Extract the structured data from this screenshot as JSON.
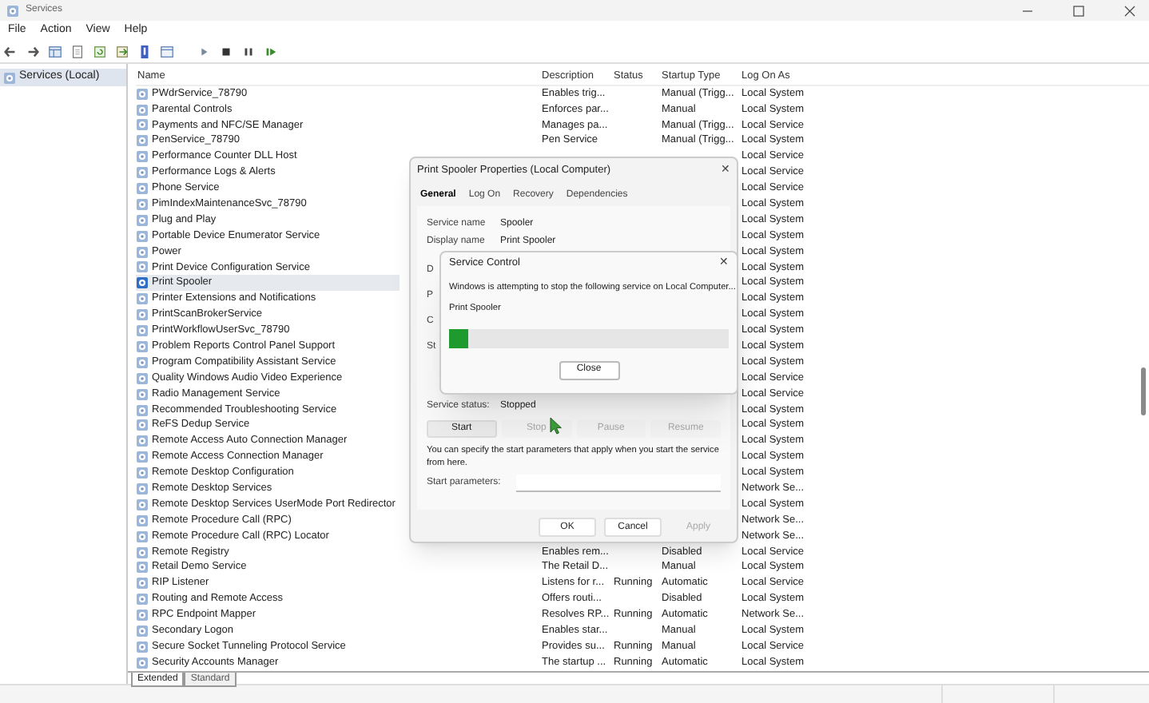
{
  "window": {
    "title": "Services"
  },
  "menu": [
    {
      "label": "File"
    },
    {
      "label": "Action"
    },
    {
      "label": "View"
    },
    {
      "label": "Help"
    }
  ],
  "tree": {
    "items": [
      {
        "label": "Services (Local)",
        "selected": true
      }
    ]
  },
  "table": {
    "columns": [
      "Name",
      "Description",
      "Status",
      "Startup Type",
      "Log On As"
    ],
    "rows": [
      {
        "name": "PWdrService_78790",
        "description": "Enables trig...",
        "startup_type": "Manual (Trigg...",
        "log_on_as": "Local System",
        "selected": false
      },
      {
        "name": "Parental Controls",
        "description": "Enforces par...",
        "startup_type": "Manual",
        "log_on_as": "Local System",
        "selected": false
      },
      {
        "name": "Payments and NFC/SE Manager",
        "description": "Manages pa...",
        "startup_type": "Manual (Trigg...",
        "log_on_as": "Local Service",
        "selected": false
      },
      {
        "name": "PenService_78790",
        "description": "Pen Service",
        "startup_type": "Manual (Trigg...",
        "log_on_as": "Local System",
        "selected": false
      },
      {
        "name": "Performance Counter DLL Host",
        "log_on_as": "Local Service",
        "selected": false
      },
      {
        "name": "Performance Logs & Alerts",
        "log_on_as": "Local Service",
        "selected": false
      },
      {
        "name": "Phone Service",
        "log_on_as": "Local Service",
        "selected": false
      },
      {
        "name": "PimIndexMaintenanceSvc_78790",
        "log_on_as": "Local System",
        "selected": false
      },
      {
        "name": "Plug and Play",
        "log_on_as": "Local System",
        "selected": false
      },
      {
        "name": "Portable Device Enumerator Service",
        "log_on_as": "Local System",
        "selected": false
      },
      {
        "name": "Power",
        "log_on_as": "Local System",
        "selected": false
      },
      {
        "name": "Print Device Configuration Service",
        "log_on_as": "Local System",
        "selected": false
      },
      {
        "name": "Print Spooler",
        "log_on_as": "Local System",
        "selected": true
      },
      {
        "name": "Printer Extensions and Notifications",
        "log_on_as": "Local System",
        "selected": false
      },
      {
        "name": "PrintScanBrokerService",
        "log_on_as": "Local System",
        "selected": false
      },
      {
        "name": "PrintWorkflowUserSvc_78790",
        "log_on_as": "Local System",
        "selected": false
      },
      {
        "name": "Problem Reports Control Panel Support",
        "log_on_as": "Local System",
        "selected": false
      },
      {
        "name": "Program Compatibility Assistant Service",
        "log_on_as": "Local System",
        "selected": false
      },
      {
        "name": "Quality Windows Audio Video Experience",
        "log_on_as": "Local Service",
        "selected": false
      },
      {
        "name": "Radio Management Service",
        "log_on_as": "Local Service",
        "selected": false
      },
      {
        "name": "Recommended Troubleshooting Service",
        "log_on_as": "Local System",
        "selected": false
      },
      {
        "name": "ReFS Dedup Service",
        "log_on_as": "Local System",
        "selected": false
      },
      {
        "name": "Remote Access Auto Connection Manager",
        "log_on_as": "Local System",
        "selected": false
      },
      {
        "name": "Remote Access Connection Manager",
        "log_on_as": "Local System",
        "selected": false
      },
      {
        "name": "Remote Desktop Configuration",
        "log_on_as": "Local System",
        "selected": false
      },
      {
        "name": "Remote Desktop Services",
        "log_on_as": "Network Se...",
        "selected": false
      },
      {
        "name": "Remote Desktop Services UserMode Port Redirector",
        "log_on_as": "Local System",
        "selected": false
      },
      {
        "name": "Remote Procedure Call (RPC)",
        "log_on_as": "Network Se...",
        "selected": false
      },
      {
        "name": "Remote Procedure Call (RPC) Locator",
        "log_on_as": "Network Se...",
        "selected": false
      },
      {
        "name": "Remote Registry",
        "description": "Enables rem...",
        "startup_type": "Disabled",
        "log_on_as": "Local Service",
        "selected": false
      },
      {
        "name": "Retail Demo Service",
        "description": "The Retail D...",
        "startup_type": "Manual",
        "log_on_as": "Local System",
        "selected": false
      },
      {
        "name": "RIP Listener",
        "description": "Listens for r...",
        "status": "Running",
        "startup_type": "Automatic",
        "log_on_as": "Local Service",
        "selected": false
      },
      {
        "name": "Routing and Remote Access",
        "description": "Offers routi...",
        "startup_type": "Disabled",
        "log_on_as": "Local System",
        "selected": false
      },
      {
        "name": "RPC Endpoint Mapper",
        "description": "Resolves RP...",
        "status": "Running",
        "startup_type": "Automatic",
        "log_on_as": "Network Se...",
        "selected": false
      },
      {
        "name": "Secondary Logon",
        "description": "Enables star...",
        "startup_type": "Manual",
        "log_on_as": "Local System",
        "selected": false
      },
      {
        "name": "Secure Socket Tunneling Protocol Service",
        "description": "Provides su...",
        "status": "Running",
        "startup_type": "Manual",
        "log_on_as": "Local Service",
        "selected": false
      },
      {
        "name": "Security Accounts Manager",
        "description": "The startup ...",
        "status": "Running",
        "startup_type": "Automatic",
        "log_on_as": "Local System",
        "selected": false
      }
    ]
  },
  "view_tabs": [
    {
      "label": "Extended",
      "selected": true
    },
    {
      "label": "Standard",
      "selected": false
    }
  ],
  "properties_dialog": {
    "title": "Print Spooler Properties (Local Computer)",
    "close": "✕",
    "tabs": [
      {
        "label": "General",
        "selected": true
      },
      {
        "label": "Log On",
        "selected": false
      },
      {
        "label": "Recovery",
        "selected": false
      },
      {
        "label": "Dependencies",
        "selected": false
      }
    ],
    "fields": [
      {
        "label": "Service name",
        "value": "Spooler"
      },
      {
        "label": "Display name",
        "value": "Print Spooler"
      }
    ],
    "partial_labels": [
      "D",
      "P",
      "C",
      "St"
    ],
    "status_label": "Service status:",
    "status_value": "Stopped",
    "control_buttons": [
      {
        "label": "Start",
        "disabled": false
      },
      {
        "label": "Stop",
        "disabled": true
      },
      {
        "label": "Pause",
        "disabled": true
      },
      {
        "label": "Resume",
        "disabled": true
      }
    ],
    "hint": "You can specify the start parameters that apply when you start the service from here.",
    "parameters_label": "Start parameters:",
    "buttons": [
      {
        "label": "OK",
        "disabled": false
      },
      {
        "label": "Cancel",
        "disabled": false
      },
      {
        "label": "Apply",
        "disabled": true
      }
    ]
  },
  "service_control": {
    "title": "Service Control",
    "close": "✕",
    "message": "Windows is attempting to stop the following service on Local Computer...",
    "service": "Print Spooler",
    "level": 0.07,
    "button": "Close"
  }
}
